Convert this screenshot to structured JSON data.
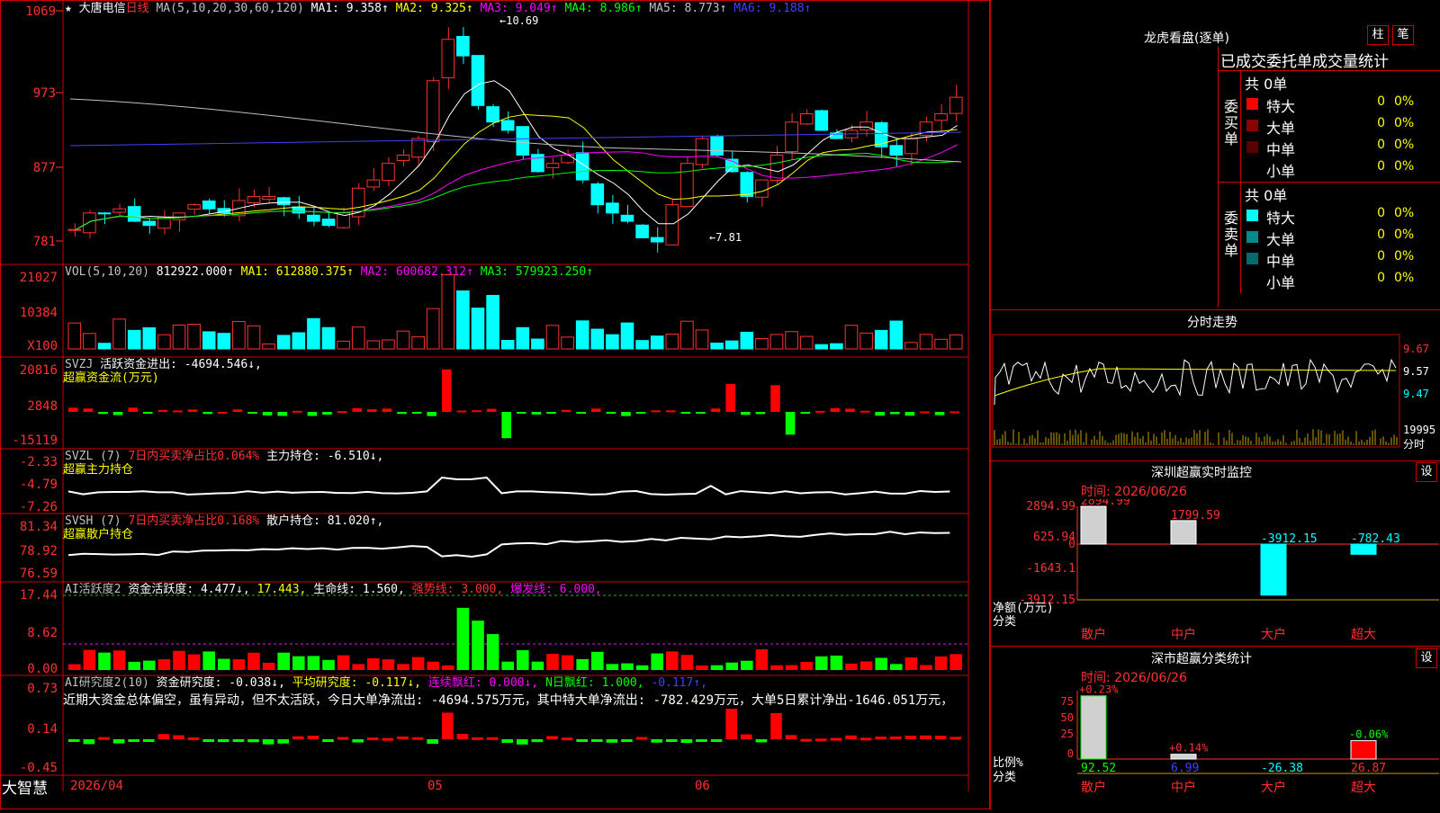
{
  "stock": {
    "name": "大唐电信",
    "period": "日线",
    "ma_line": [
      {
        "label": "MA(5,10,20,30,60,120)",
        "color": "#c0c0c0"
      },
      {
        "label": "MA1: 9.358↑",
        "color": "#ffffff"
      },
      {
        "label": "MA2: 9.325↑",
        "color": "#ffff00"
      },
      {
        "label": "MA3: 9.049↑",
        "color": "#ff00ff"
      },
      {
        "label": "MA4: 8.986↑",
        "color": "#00ff00"
      },
      {
        "label": "MA5: 8.773↑",
        "color": "#c0c0c0"
      },
      {
        "label": "MA6: 9.188↑",
        "color": "#4040ff"
      }
    ],
    "price_axis": [
      "1069",
      "973",
      "877",
      "781"
    ],
    "high_label": "10.69",
    "low_label": "7.81"
  },
  "panels": {
    "vol": {
      "header": [
        {
          "label": "VOL(5,10,20)",
          "color": "#c0c0c0"
        },
        {
          "label": "812922.000↑",
          "color": "#ffffff"
        },
        {
          "label": "MA1: 612880.375↑",
          "color": "#ffff00"
        },
        {
          "label": "MA2: 600682.312↑",
          "color": "#ff00ff"
        },
        {
          "label": "MA3: 579923.250↑",
          "color": "#00ff00"
        }
      ],
      "axis": [
        "21027",
        "10384",
        "X100"
      ]
    },
    "svzj": {
      "header": [
        {
          "label": "SVZJ",
          "color": "#c0c0c0"
        },
        {
          "label": "活跃资金进出: -4694.546↓,",
          "color": "#ffffff"
        }
      ],
      "subtitle": "超赢资金流(万元)",
      "axis": [
        "20816",
        "2848",
        "-15119"
      ]
    },
    "svzl": {
      "header": [
        {
          "label": "SVZL (7)",
          "color": "#c0c0c0"
        },
        {
          "label": "7日内买卖净占比0.064%",
          "color": "#ff3030"
        },
        {
          "label": "主力持仓: -6.510↓,",
          "color": "#ffffff"
        }
      ],
      "subtitle": "超赢主力持仓",
      "axis": [
        "-2.33",
        "-4.79",
        "-7.26"
      ]
    },
    "svsh": {
      "header": [
        {
          "label": "SVSH (7)",
          "color": "#c0c0c0"
        },
        {
          "label": "7日内买卖净占比0.168%",
          "color": "#ff3030"
        },
        {
          "label": "散户持仓: 81.020↑,",
          "color": "#ffffff"
        }
      ],
      "subtitle": "超赢散户持仓",
      "axis": [
        "81.34",
        "78.92",
        "76.59"
      ]
    },
    "ai_active": {
      "header": [
        {
          "label": "AI活跃度2",
          "color": "#c0c0c0"
        },
        {
          "label": "资金活跃度: 4.477↓,",
          "color": "#ffffff"
        },
        {
          "label": "17.443,",
          "color": "#ffff00"
        },
        {
          "label": "生命线: 1.560,",
          "color": "#ffffff"
        },
        {
          "label": "强势线: 3.000,",
          "color": "#ff3030"
        },
        {
          "label": "爆发线: 6.000,",
          "color": "#ff00ff"
        }
      ],
      "axis": [
        "17.44",
        "8.62",
        "0.00"
      ]
    },
    "ai_research": {
      "header": [
        {
          "label": "AI研究度2(10)",
          "color": "#c0c0c0"
        },
        {
          "label": "资金研究度: -0.038↓,",
          "color": "#ffffff"
        },
        {
          "label": "平均研究度: -0.117↓,",
          "color": "#ffff00"
        },
        {
          "label": "连续飘红: 0.000↓,",
          "color": "#ff00ff"
        },
        {
          "label": "N日飘红: 1.000,",
          "color": "#00ff00"
        },
        {
          "label": "-0.117↑,",
          "color": "#4040ff"
        }
      ],
      "comment": "近期大资金总体偏空，虽有异动，但不太活跃，今日大单净流出: -4694.575万元，其中特大单净流出: -782.429万元，大单5日累计净出-1646.051万元，",
      "axis": [
        "0.73",
        "0.14",
        "-0.45"
      ]
    }
  },
  "date_axis": {
    "start": "2026/04",
    "m1": "05",
    "m2": "06"
  },
  "brand": "大智慧",
  "right": {
    "dragon": {
      "title": "龙虎看盘(逐单)",
      "tab_bar": "柱",
      "tab_bi": "笔",
      "heading": "已成交委托单成交量统计",
      "buy": {
        "side_label": "委买单",
        "total": "共 0单",
        "rows": [
          {
            "label": "特大",
            "value": "0",
            "pct": "0%",
            "color": "#ff0000"
          },
          {
            "label": "大单",
            "value": "0",
            "pct": "0%",
            "color": "#8b0000"
          },
          {
            "label": "中单",
            "value": "0",
            "pct": "0%",
            "color": "#5a0000"
          },
          {
            "label": "小单",
            "value": "0",
            "pct": "0%",
            "color": "#000000"
          }
        ]
      },
      "sell": {
        "side_label": "委卖单",
        "total": "共 0单",
        "rows": [
          {
            "label": "特大",
            "value": "0",
            "pct": "0%",
            "color": "#00ffff"
          },
          {
            "label": "大单",
            "value": "0",
            "pct": "0%",
            "color": "#008b8b"
          },
          {
            "label": "中单",
            "value": "0",
            "pct": "0%",
            "color": "#006b6b"
          },
          {
            "label": "小单",
            "value": "0",
            "pct": "0%",
            "color": "#000000"
          }
        ]
      }
    },
    "intraday": {
      "title": "分时走势",
      "price_labels": [
        "9.67",
        "9.57",
        "9.47"
      ],
      "vol_label": "19995",
      "vol_caption": "分时"
    },
    "monitor": {
      "title": "深圳超赢实时监控",
      "set_label": "设",
      "time": "时间: 2026/06/26",
      "axis": [
        "2894.99",
        "625.94",
        "0",
        "-1643.1",
        "-3912.15"
      ],
      "y_caption": "净额(万元)",
      "x_caption": "分类",
      "chart_data": {
        "type": "bar",
        "categories": [
          "散户",
          "中户",
          "大户",
          "超大"
        ],
        "values": [
          2894.99,
          1799.59,
          -3912.15,
          -782.43
        ],
        "value_labels": [
          "2894.99",
          "1799.59",
          "-3912.15",
          "-782.43"
        ],
        "ylabel": "净额(万元)",
        "ylim": [
          -3912.15,
          2894.99
        ]
      }
    },
    "classify": {
      "title": "深市超赢分类统计",
      "set_label": "设",
      "time": "时间: 2026/06/26",
      "axis": [
        "75",
        "50",
        "25",
        "0"
      ],
      "y_caption": "比例%",
      "x_caption": "分类",
      "chart_data": {
        "type": "bar",
        "categories": [
          "散户",
          "中户",
          "大户",
          "超大"
        ],
        "values": [
          92.52,
          6.99,
          -26.38,
          26.87
        ],
        "value_labels": [
          "92.52",
          "6.99",
          "-26.38",
          "26.87"
        ],
        "change_labels": [
          "+0.23%",
          "+0.14%",
          "",
          "-0.06%"
        ],
        "ylabel": "比例%",
        "ylim": [
          0,
          100
        ]
      }
    }
  }
}
